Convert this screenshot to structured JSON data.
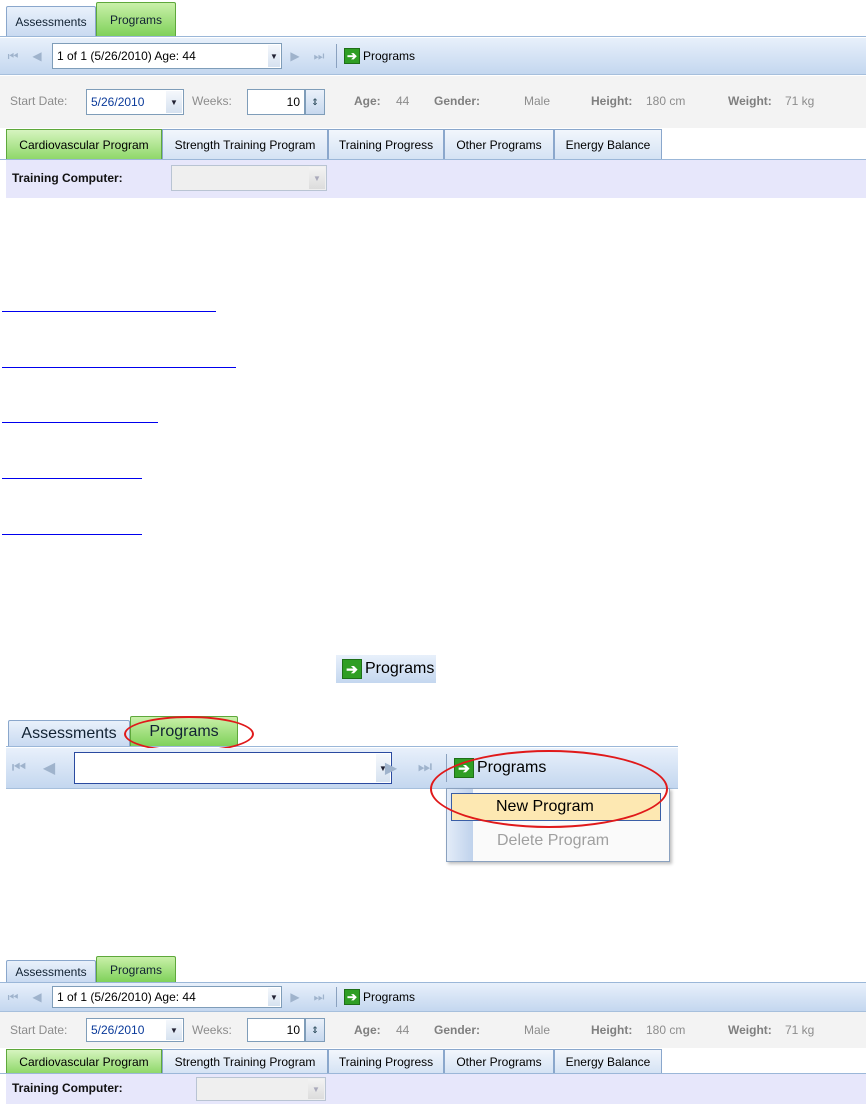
{
  "tabs": [
    "Assessments",
    "Programs"
  ],
  "nav": {
    "record_text": "1 of 1 (5/26/2010) Age: 44",
    "programs_label": "Programs"
  },
  "params": {
    "start_label": "Start Date:",
    "start_value": "5/26/2010",
    "weeks_label": "Weeks:",
    "weeks_value": "10",
    "age_label": "Age:",
    "age_value": "44",
    "gender_label": "Gender:",
    "gender_value": "Male",
    "height_label": "Height:",
    "height_value": "180 cm",
    "weight_label": "Weight:",
    "weight_value": "71 kg"
  },
  "subtabs": [
    "Cardiovascular Program",
    "Strength Training Program",
    "Training Progress",
    "Other Programs",
    "Energy Balance"
  ],
  "training_computer_label": "Training Computer:",
  "standalone_button": "Programs",
  "menu": {
    "new_program": "New Program",
    "delete_program": "Delete Program"
  },
  "colors": {
    "active_tab": "#7fd15a",
    "link": "#0000ee",
    "highlight": "#e0191a"
  }
}
